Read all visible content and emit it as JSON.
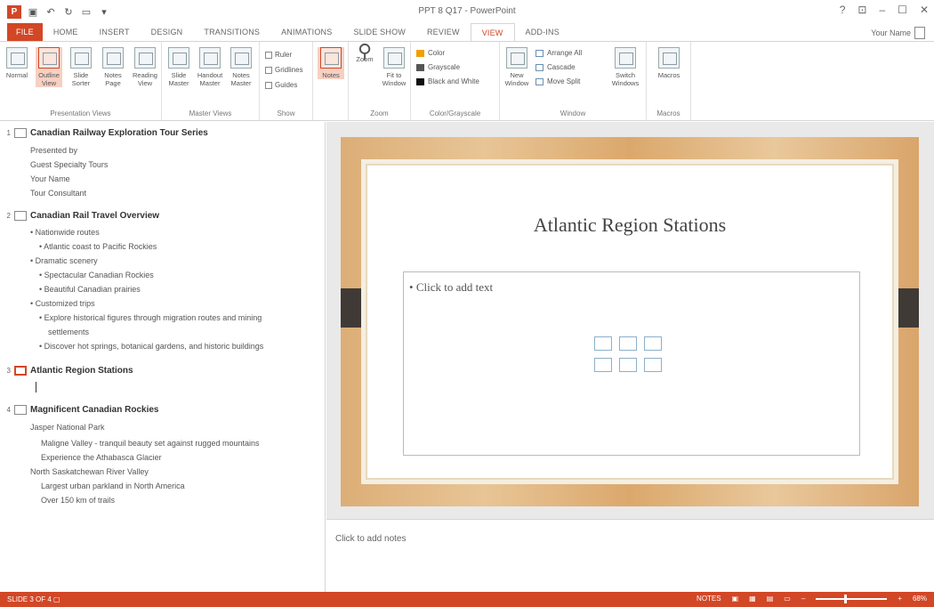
{
  "window": {
    "title": "PPT 8 Q17 - PowerPoint",
    "controls": [
      "?",
      "⊡",
      "–",
      "☐",
      "✕"
    ]
  },
  "qat": {
    "icons": [
      "save-icon",
      "undo-icon",
      "redo-icon",
      "start-from-beginning-icon",
      "customize-icon"
    ]
  },
  "tabs": [
    {
      "label": "FILE"
    },
    {
      "label": "HOME"
    },
    {
      "label": "INSERT"
    },
    {
      "label": "DESIGN"
    },
    {
      "label": "TRANSITIONS"
    },
    {
      "label": "ANIMATIONS"
    },
    {
      "label": "SLIDE SHOW"
    },
    {
      "label": "REVIEW"
    },
    {
      "label": "VIEW"
    },
    {
      "label": "ADD-INS"
    }
  ],
  "user": {
    "name": "Your Name"
  },
  "ribbon": {
    "presentation_views": {
      "label": "Presentation Views",
      "buttons": [
        {
          "label": "Normal"
        },
        {
          "label": "Outline View"
        },
        {
          "label": "Slide Sorter"
        },
        {
          "label": "Notes Page"
        },
        {
          "label": "Reading View"
        }
      ]
    },
    "master_views": {
      "label": "Master Views",
      "buttons": [
        {
          "label": "Slide Master"
        },
        {
          "label": "Handout Master"
        },
        {
          "label": "Notes Master"
        }
      ]
    },
    "show": {
      "label": "Show",
      "checks": [
        {
          "label": "Ruler"
        },
        {
          "label": "Gridlines"
        },
        {
          "label": "Guides"
        }
      ]
    },
    "notes": {
      "label": "Notes"
    },
    "zoom": {
      "label": "Zoom",
      "buttons": [
        {
          "label": "Zoom"
        },
        {
          "label": "Fit to Window"
        }
      ]
    },
    "color": {
      "label": "Color/Grayscale",
      "items": [
        {
          "label": "Color",
          "swatch": "#f0a000"
        },
        {
          "label": "Grayscale",
          "swatch": "#555555"
        },
        {
          "label": "Black and White",
          "swatch": "#111111"
        }
      ]
    },
    "window": {
      "label": "Window",
      "new_window": "New Window",
      "items": [
        {
          "label": "Arrange All"
        },
        {
          "label": "Cascade"
        },
        {
          "label": "Move Split"
        }
      ],
      "switch": "Switch Windows"
    },
    "macros": {
      "label": "Macros",
      "button": "Macros"
    }
  },
  "outline": {
    "slides": [
      {
        "num": "1",
        "title": "Canadian Railway Exploration Tour Series",
        "lines": [
          "Presented by",
          "Guest Specialty Tours",
          "Your Name",
          "Tour Consultant"
        ]
      },
      {
        "num": "2",
        "title": "Canadian Rail Travel Overview",
        "lines": [
          "• Nationwide routes",
          "• Atlantic coast to Pacific Rockies",
          "• Dramatic scenery",
          "• Spectacular Canadian Rockies",
          "• Beautiful Canadian prairies",
          "• Customized trips",
          "• Explore historical figures through migration routes and mining",
          "settlements",
          "• Discover hot springs, botanical gardens, and historic buildings"
        ]
      },
      {
        "num": "3",
        "title": "Atlantic Region Stations",
        "lines": []
      },
      {
        "num": "4",
        "title": "Magnificent Canadian Rockies",
        "lines": [
          "Jasper National Park",
          "Maligne Valley - tranquil beauty set against rugged mountains",
          "Experience the Athabasca Glacier",
          "North Saskatchewan River Valley",
          "Largest urban parkland in North America",
          "Over 150 km of trails"
        ]
      }
    ]
  },
  "slide": {
    "title": "Atlantic Region Stations",
    "placeholder": "Click to add text"
  },
  "notes": {
    "placeholder": "Click to add notes"
  },
  "status": {
    "slide_info": "SLIDE 3 OF 4",
    "notes_label": "NOTES",
    "zoom": "68%"
  },
  "colors": {
    "accent": "#d24726",
    "slide_wood": "#dcae77",
    "slide_tab": "#3f3a36"
  }
}
